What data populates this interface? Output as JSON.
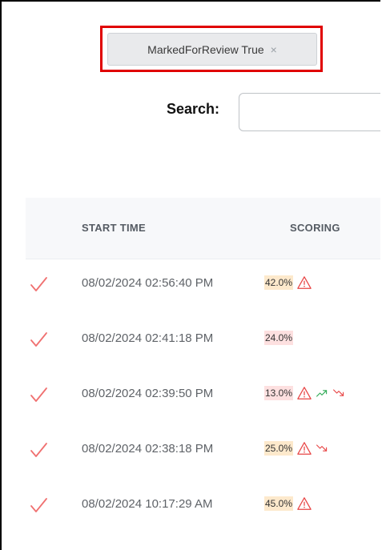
{
  "filter_chip": {
    "label": "MarkedForReview True",
    "close_glyph": "×"
  },
  "search": {
    "label": "Search:",
    "value": "",
    "placeholder": ""
  },
  "table": {
    "columns": [
      "",
      "START TIME",
      "SCORING"
    ],
    "rows": [
      {
        "status_icon": "check-icon",
        "start_time": "08/02/2024 02:56:40 PM",
        "score": "42.0%",
        "score_color": "#fde9cc",
        "icons": [
          "warning-icon"
        ]
      },
      {
        "status_icon": "check-icon",
        "start_time": "08/02/2024 02:41:18 PM",
        "score": "24.0%",
        "score_color": "#fde0e0",
        "icons": []
      },
      {
        "status_icon": "check-icon",
        "start_time": "08/02/2024 02:39:50 PM",
        "score": "13.0%",
        "score_color": "#fde0e0",
        "icons": [
          "warning-icon",
          "trend-up-icon",
          "trend-down-icon"
        ]
      },
      {
        "status_icon": "check-icon",
        "start_time": "08/02/2024 02:38:18 PM",
        "score": "25.0%",
        "score_color": "#fde9cc",
        "icons": [
          "warning-icon",
          "trend-down-icon"
        ]
      },
      {
        "status_icon": "check-icon",
        "start_time": "08/02/2024 10:17:29 AM",
        "score": "45.0%",
        "score_color": "#fde9cc",
        "icons": [
          "warning-icon"
        ]
      }
    ]
  },
  "colors": {
    "highlight_border": "#e00000",
    "check": "#f07070",
    "warning": "#e84545",
    "trend_up": "#2eaa55",
    "trend_down": "#e84545"
  }
}
